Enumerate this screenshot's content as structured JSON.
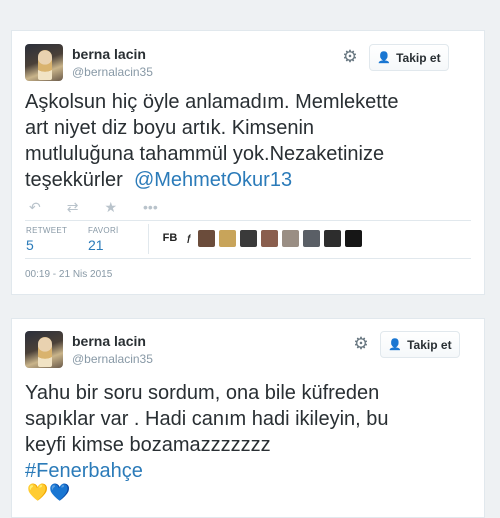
{
  "tweets": [
    {
      "name": "berna lacin",
      "handle": "@bernalacin35",
      "follow_label": "Takip et",
      "text_lines": [
        "Aşkolsun hiç öyle anlamadım. Memlekette",
        "art niyet diz boyu artık. Kimsenin",
        "mutluluğuna tahammül yok.Nezaketinize",
        "teşekkürler"
      ],
      "mention": "@MehmetOkur13",
      "retweet_label": "RETWEET",
      "retweet_count": "5",
      "favori_label": "FAVORİ",
      "favori_count": "21",
      "favoriters": [
        "FB",
        "ƒ",
        "",
        "",
        "",
        "",
        "",
        "",
        "",
        ""
      ],
      "timestamp": "00:19 - 21 Nis 2015",
      "icons": {
        "reply": "reply-icon",
        "retweet": "retweet-icon",
        "favorite": "star-icon",
        "more": "more-icon",
        "gear": "gear-icon"
      }
    },
    {
      "name": "berna lacin",
      "handle": "@bernalacin35",
      "follow_label": "Takip et",
      "text_lines": [
        "Yahu bir soru sordum, ona bile küfreden",
        "sapıklar var . Hadi canım hadi ikileyin, bu",
        "keyfi kimse bozamazzzzzzz"
      ],
      "hashtag": "#Fenerbahçe",
      "hearts": "💛💙"
    }
  ],
  "colors": {
    "link": "#2b7bb9",
    "background": "#eef1f3",
    "muted": "#8899a6"
  }
}
